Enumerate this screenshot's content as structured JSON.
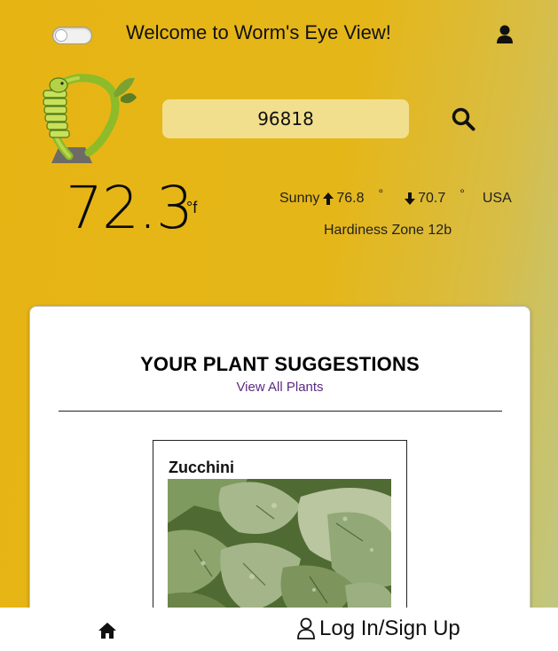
{
  "header": {
    "welcome_text": "Welcome to Worm's Eye View!",
    "theme_toggle": "off"
  },
  "search": {
    "value": "96818"
  },
  "weather": {
    "temperature": "72.3",
    "unit": "°f",
    "condition": "Sunny",
    "high": "76.8",
    "low": "70.7",
    "degree_symbol": "°",
    "country": "USA",
    "hardiness_zone": "Hardiness Zone 12b"
  },
  "suggestions": {
    "title": "YOUR PLANT SUGGESTIONS",
    "view_all_label": "View All Plants",
    "plants": [
      {
        "name": "Zucchini"
      }
    ]
  },
  "bottom_nav": {
    "login_label": "Log In/Sign Up"
  },
  "colors": {
    "background": "#e6b514",
    "search_bg": "#f2df8e",
    "link": "#5b2a80"
  },
  "icons": [
    "user-icon",
    "search-icon",
    "arrow-up-icon",
    "arrow-down-icon",
    "home-icon",
    "user-outline-icon",
    "worm-logo"
  ]
}
